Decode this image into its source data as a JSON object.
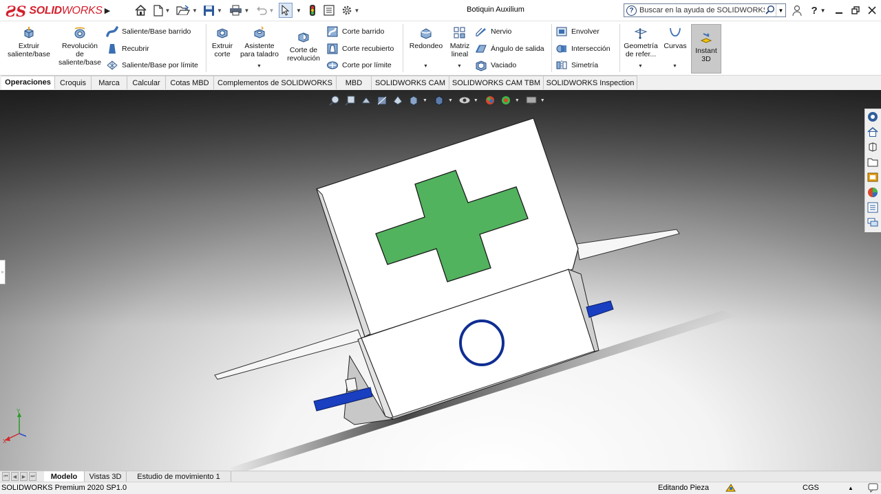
{
  "app": {
    "brand_prefix": "SOLID",
    "brand_suffix": "WORKS",
    "document_title": "Botiquin Auxilium"
  },
  "help_search": {
    "placeholder": "Buscar en la ayuda de SOLIDWORKS"
  },
  "ribbon": {
    "extrude_boss": "Extruir saliente/base",
    "revolve_boss": "Revolución de saliente/base",
    "swept_boss": "Saliente/Base barrido",
    "loft_boss": "Recubrir",
    "boundary_boss": "Saliente/Base por límite",
    "extrude_cut": "Extruir corte",
    "hole_wizard": "Asistente para taladro",
    "revolve_cut": "Corte de revolución",
    "swept_cut": "Corte barrido",
    "lofted_cut": "Corte recubierto",
    "boundary_cut": "Corte por límite",
    "fillet": "Redondeo",
    "linear_pattern": "Matriz lineal",
    "rib": "Nervio",
    "draft": "Ángulo de salida",
    "shell": "Vaciado",
    "wrap": "Envolver",
    "intersect": "Intersección",
    "mirror": "Simetría",
    "reference_geometry": "Geometría de refer...",
    "curves": "Curvas",
    "instant3d": "Instant 3D"
  },
  "tabs": [
    "Operaciones",
    "Croquis",
    "Marca",
    "Calcular",
    "Cotas MBD",
    "Complementos de SOLIDWORKS",
    "MBD",
    "SOLIDWORKS CAM",
    "SOLIDWORKS CAM TBM",
    "SOLIDWORKS Inspection"
  ],
  "bottom_tabs": [
    "Modelo",
    "Vistas 3D",
    "Estudio de movimiento 1"
  ],
  "status": {
    "version": "SOLIDWORKS Premium 2020 SP1.0",
    "mode": "Editando Pieza",
    "units": "CGS"
  },
  "triad": {
    "y": "Y",
    "x": "X"
  },
  "colors": {
    "brand_red": "#d41f2c",
    "cross_green": "#52b35e",
    "ring_blue": "#0f2d93",
    "knob_blue": "#1a3fc0",
    "instant3d_bg": "#c9c9c9"
  },
  "icons": {
    "home": "home-icon",
    "new": "new-document-icon",
    "open": "open-folder-icon",
    "save": "save-icon",
    "print": "print-icon",
    "undo": "undo-icon",
    "select": "select-pointer-icon",
    "rebuild": "rebuild-traffic-light-icon",
    "file_properties": "file-properties-icon",
    "options": "gear-icon"
  }
}
